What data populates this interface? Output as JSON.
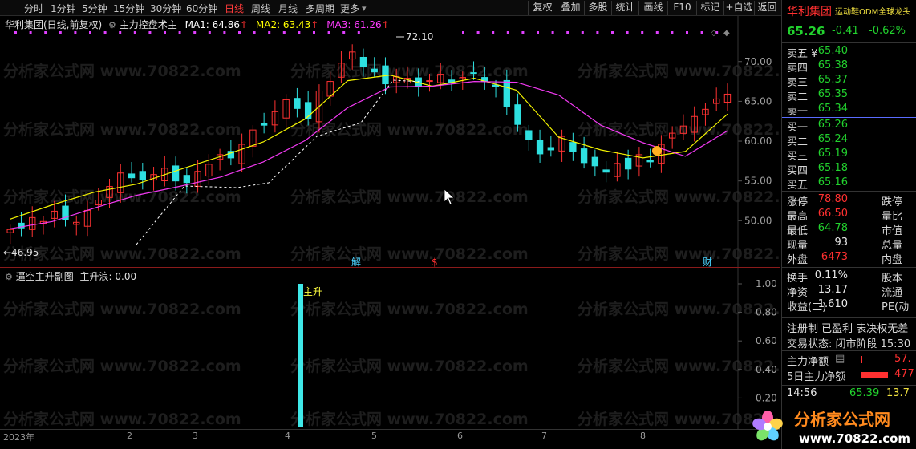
{
  "toolbar": {
    "periods": [
      "分时",
      "1分钟",
      "5分钟",
      "15分钟",
      "30分钟",
      "60分钟",
      "日线",
      "周线",
      "月线",
      "多周期",
      "更多"
    ],
    "active_period": "日线",
    "buttons": [
      "复权",
      "叠加",
      "多股",
      "统计",
      "画线",
      "F10",
      "标记",
      "+自选",
      "返回"
    ]
  },
  "main_legend": {
    "title": "华利集团(日线,前复权)",
    "indicator": "主力控盘术主",
    "ma1": "MA1: 64.86",
    "ma2": "MA2: 63.43",
    "ma3": "MA3: 61.26",
    "colors": {
      "ma1": "#ffffff",
      "ma2": "#ffff00",
      "ma3": "#ff3cff"
    }
  },
  "sub_legend": {
    "title": "逼空主升副图",
    "value": "主升浪: 0.00"
  },
  "annotations": {
    "high": "72.10",
    "low": "←46.95",
    "jie": "解",
    "dollar": "$",
    "cai": "财",
    "zhusheng": "主升"
  },
  "watermark": "分析家公式网 www.70822.com",
  "date_axis": [
    "2023年",
    "2",
    "3",
    "4",
    "5",
    "6",
    "7",
    "8"
  ],
  "chart_data": [
    {
      "type": "candlestick",
      "title": "华利集团(日线,前复权)",
      "y_ticks": [
        "70.00",
        "65.00",
        "60.00",
        "55.00",
        "50.00"
      ],
      "ylim": [
        45.5,
        73.5
      ],
      "x_labels": [
        "2023年",
        "2",
        "3",
        "4",
        "5",
        "6",
        "7",
        "8"
      ],
      "series": [
        {
          "name": "MA1",
          "values": []
        },
        {
          "name": "MA2",
          "values": [
            50.2,
            52.0,
            53.6,
            54.6,
            56.4,
            58.1,
            59.9,
            62.8,
            67.6,
            68.3,
            66.9,
            67.9,
            66.4,
            60.5,
            58.9,
            57.9,
            58.7,
            63.4
          ]
        },
        {
          "name": "MA3",
          "values": [
            49.0,
            49.9,
            51.6,
            53.2,
            54.3,
            55.5,
            57.4,
            60.1,
            64.2,
            66.8,
            66.9,
            67.5,
            67.4,
            65.8,
            62.0,
            59.8,
            58.1,
            61.3
          ]
        }
      ],
      "candles_close": [
        48.9,
        49.1,
        50.4,
        49.9,
        51.2,
        50.1,
        49.8,
        51.3,
        52.6,
        54.3,
        56.0,
        55.4,
        55.2,
        55.8,
        56.6,
        55.0,
        54.8,
        56.2,
        57.1,
        58.3,
        57.9,
        59.6,
        61.4,
        62.0,
        63.7,
        65.2,
        64.1,
        62.8,
        66.3,
        67.5,
        69.8,
        71.2,
        69.4,
        68.7,
        67.2,
        68.1,
        67.9,
        66.8,
        67.6,
        68.4,
        67.4,
        68.0,
        68.6,
        67.5,
        66.9,
        64.3,
        62.1,
        60.2,
        58.4,
        58.9,
        60.6,
        58.7,
        57.3,
        56.9,
        56.1,
        57.2,
        56.5,
        58.3,
        57.4,
        59.6,
        61.0,
        61.9,
        63.1,
        64.0,
        65.3,
        65.9
      ]
    },
    {
      "type": "bar",
      "title": "逼空主升副图",
      "y_ticks": [
        "1.00",
        "0.80",
        "0.60",
        "0.40",
        "0.20"
      ],
      "ylim": [
        0,
        1.0
      ],
      "categories": [
        "主升"
      ],
      "values": [
        1.0
      ]
    }
  ],
  "right_panel": {
    "name": "华利集团",
    "concept": "运动鞋ODM全球龙头",
    "price": "65.26",
    "change": "-0.41",
    "pct": "-0.62%",
    "asks": [
      {
        "label": "卖五 ¥",
        "price": "65.40"
      },
      {
        "label": "卖四",
        "price": "65.38"
      },
      {
        "label": "卖三",
        "price": "65.37"
      },
      {
        "label": "卖二",
        "price": "65.35"
      },
      {
        "label": "卖一",
        "price": "65.34"
      }
    ],
    "bids": [
      {
        "label": "买一",
        "price": "65.26"
      },
      {
        "label": "买二",
        "price": "65.24"
      },
      {
        "label": "买三",
        "price": "65.19"
      },
      {
        "label": "买四",
        "price": "65.18"
      },
      {
        "label": "买五",
        "price": "65.16"
      }
    ],
    "stats": [
      {
        "label": "涨停",
        "value": "78.80",
        "color": "red",
        "label2": "跌停"
      },
      {
        "label": "最高",
        "value": "66.50",
        "color": "red",
        "label2": "量比"
      },
      {
        "label": "最低",
        "value": "64.78",
        "color": "green",
        "label2": "市值"
      },
      {
        "label": "现量",
        "value": "93",
        "color": "white",
        "label2": "总量"
      },
      {
        "label": "外盘",
        "value": "6473",
        "color": "red",
        "label2": "内盘"
      }
    ],
    "stats2": [
      {
        "label": "换手",
        "value": "0.11%",
        "label2": "股本"
      },
      {
        "label": "净资",
        "value": "13.17",
        "label2": "流通"
      },
      {
        "label": "收益(二)",
        "value": "1.610",
        "label2": "PE(动"
      }
    ],
    "tags": "注册制  已盈利  表决权无差",
    "trade_status": "交易状态: 闭市阶段 15:30",
    "fund_flow": {
      "label": "主力净额",
      "value": "57."
    },
    "fund_flow5": {
      "label": "5日主力净额",
      "value": "477"
    },
    "tick": {
      "time": "14:56",
      "price": "65.39",
      "vol": "13.7"
    }
  }
}
